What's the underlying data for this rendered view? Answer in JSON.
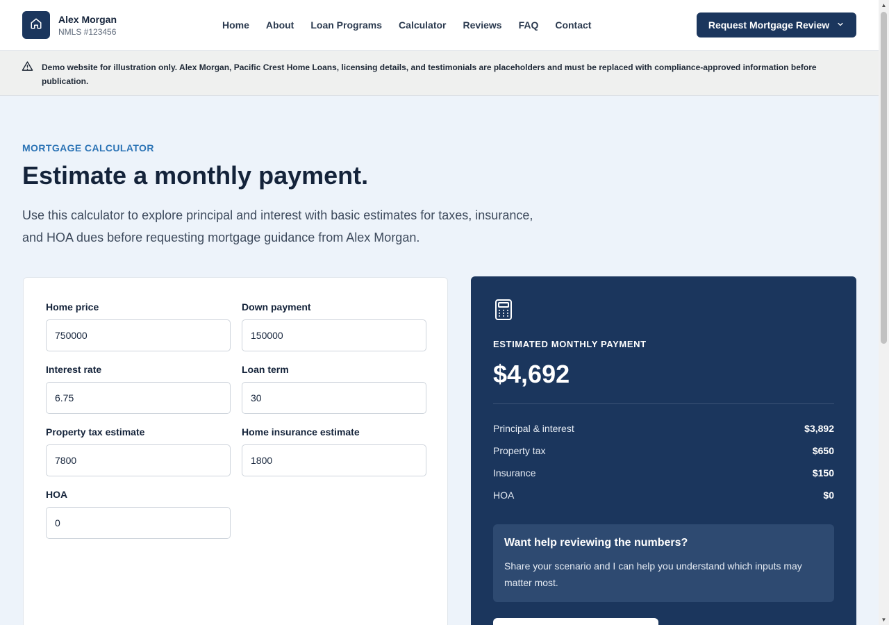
{
  "header": {
    "logo_icon": "home-icon",
    "brand_name": "Alex Morgan",
    "brand_nmls": "NMLS #123456",
    "nav": [
      "Home",
      "About",
      "Loan Programs",
      "Calculator",
      "Reviews",
      "FAQ",
      "Contact"
    ],
    "cta_label": "Request Mortgage Review",
    "cta_icon": "chevron-down-icon"
  },
  "notice": {
    "icon": "warning-icon",
    "text": "Demo website for illustration only. Alex Morgan, Pacific Crest Home Loans, licensing details, and testimonials are placeholders and must be replaced with compliance-approved information before publication."
  },
  "hero": {
    "eyebrow": "MORTGAGE CALCULATOR",
    "title": "Estimate a monthly payment.",
    "intro": "Use this calculator to explore principal and interest with basic estimates for taxes, insurance, and HOA dues before requesting mortgage guidance from Alex Morgan."
  },
  "form": {
    "home_price": {
      "label": "Home price",
      "value": "750000"
    },
    "down_payment": {
      "label": "Down payment",
      "value": "150000"
    },
    "interest_rate": {
      "label": "Interest rate",
      "value": "6.75"
    },
    "loan_term": {
      "label": "Loan term",
      "value": "30"
    },
    "property_tax": {
      "label": "Property tax estimate",
      "value": "7800"
    },
    "home_insurance": {
      "label": "Home insurance estimate",
      "value": "1800"
    },
    "hoa": {
      "label": "HOA",
      "value": "0"
    }
  },
  "result": {
    "icon": "calculator-icon",
    "label": "ESTIMATED MONTHLY PAYMENT",
    "amount": "$4,692",
    "rows": [
      {
        "label": "Principal & interest",
        "value": "$3,892"
      },
      {
        "label": "Property tax",
        "value": "$650"
      },
      {
        "label": "Insurance",
        "value": "$150"
      },
      {
        "label": "HOA",
        "value": "$0"
      }
    ],
    "help_title": "Want help reviewing the numbers?",
    "help_text": "Share your scenario and I can help you understand which inputs may matter most."
  },
  "colors": {
    "brand_navy": "#1b365d",
    "accent_blue": "#2b73b5",
    "page_background": "#edf3fa",
    "notice_background": "#eff0ef"
  }
}
